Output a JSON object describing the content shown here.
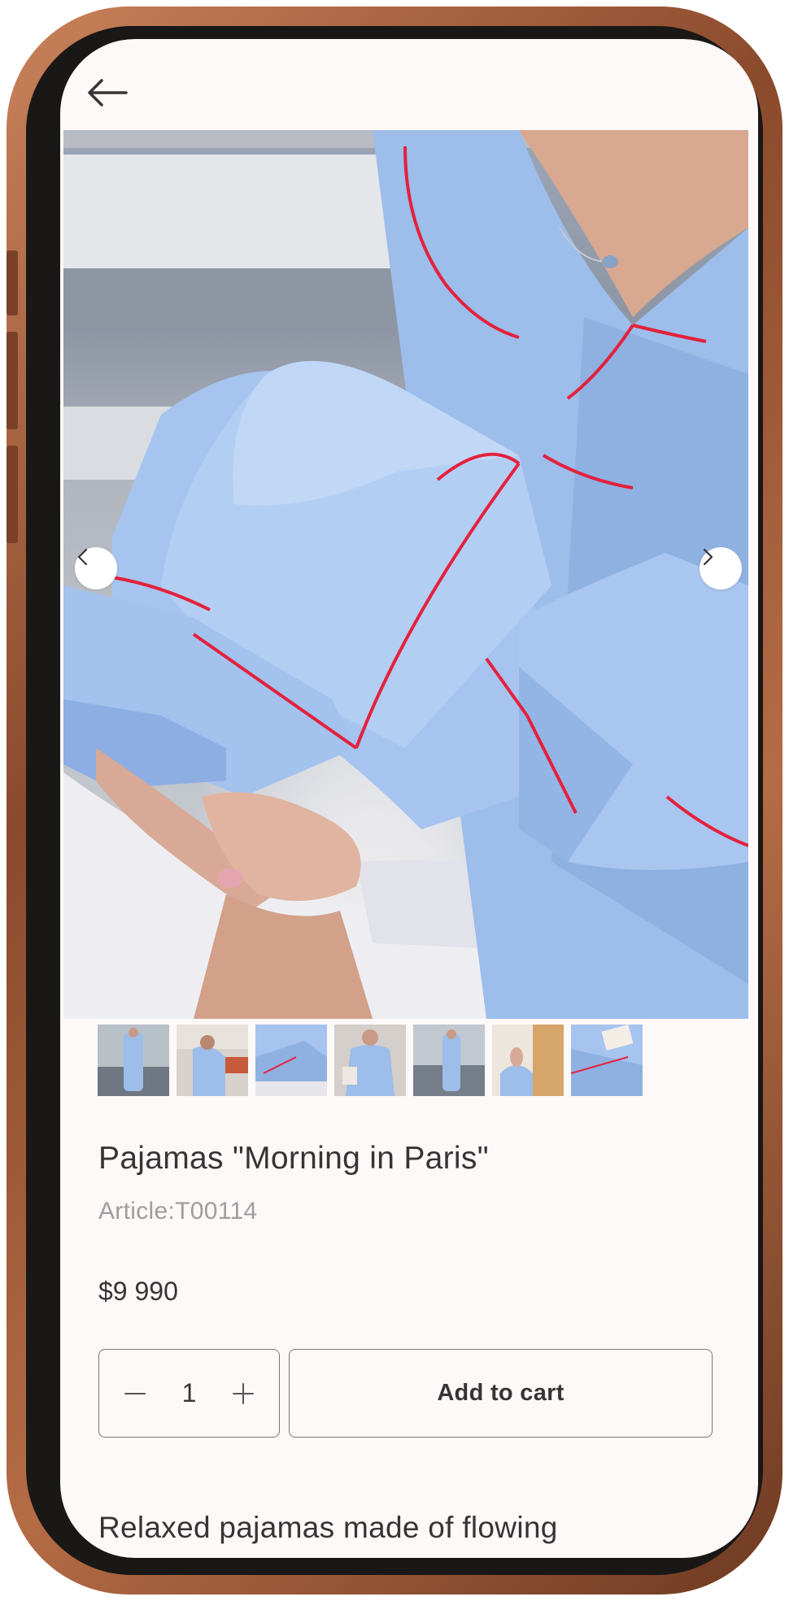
{
  "header": {
    "back_icon": "arrow-left-icon"
  },
  "gallery": {
    "prev_icon": "chevron-left-icon",
    "next_icon": "chevron-right-icon",
    "thumbnail_count": 7
  },
  "product": {
    "title": "Pajamas \"Morning in Paris\"",
    "article_label": "Article:",
    "article_value": "T00114",
    "price": "$9 990",
    "quantity": "1",
    "add_to_cart_label": "Add to cart",
    "description_preview": "Relaxed pajamas made of flowing"
  },
  "colors": {
    "frame": "#a55f3a",
    "screen_bg": "#fdf9f8",
    "text": "#3a3336",
    "muted": "#a39b9d",
    "fabric_blue": "#9fc0ef",
    "piping_red": "#e4213c"
  }
}
